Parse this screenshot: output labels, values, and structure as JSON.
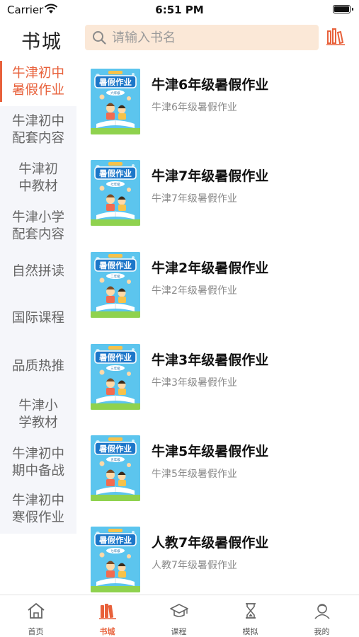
{
  "status_bar": {
    "carrier": "Carrier",
    "time": "6:51 PM"
  },
  "header": {
    "title": "书城"
  },
  "search": {
    "placeholder": "请输入书名"
  },
  "sidebar": {
    "items": [
      {
        "label_line1": "牛津初中",
        "label_line2": "暑假作业",
        "active": true
      },
      {
        "label_line1": "牛津初中",
        "label_line2": "配套内容",
        "active": false
      },
      {
        "label_line1": "牛津初",
        "label_line2": "中教材",
        "active": false
      },
      {
        "label_line1": "牛津小学",
        "label_line2": "配套内容",
        "active": false
      },
      {
        "label_line1": "自然拼读",
        "label_line2": "",
        "active": false
      },
      {
        "label_line1": "国际课程",
        "label_line2": "",
        "active": false
      },
      {
        "label_line1": "品质热推",
        "label_line2": "",
        "active": false
      },
      {
        "label_line1": "牛津小",
        "label_line2": "学教材",
        "active": false
      },
      {
        "label_line1": "牛津初中",
        "label_line2": "期中备战",
        "active": false
      },
      {
        "label_line1": "牛津初中",
        "label_line2": "寒假作业",
        "active": false
      }
    ]
  },
  "books": [
    {
      "title": "牛津6年级暑假作业",
      "subtitle": "牛津6年级暑假作业",
      "cover_text": "暑假作业",
      "cover_grade": "六年级"
    },
    {
      "title": "牛津7年级暑假作业",
      "subtitle": "牛津7年级暑假作业",
      "cover_text": "暑假作业",
      "cover_grade": "七年级"
    },
    {
      "title": "牛津2年级暑假作业",
      "subtitle": "牛津2年级暑假作业",
      "cover_text": "暑假作业",
      "cover_grade": "二年级"
    },
    {
      "title": "牛津3年级暑假作业",
      "subtitle": "牛津3年级暑假作业",
      "cover_text": "暑假作业",
      "cover_grade": "三年级"
    },
    {
      "title": "牛津5年级暑假作业",
      "subtitle": "牛津5年级暑假作业",
      "cover_text": "暑假作业",
      "cover_grade": "五年级"
    },
    {
      "title": "人教7年级暑假作业",
      "subtitle": "人教7年级暑假作业",
      "cover_text": "暑假作业",
      "cover_grade": "七年级"
    }
  ],
  "tabbar": {
    "tabs": [
      {
        "label": "首页",
        "icon": "home-icon",
        "active": false
      },
      {
        "label": "书城",
        "icon": "books-icon",
        "active": true
      },
      {
        "label": "课程",
        "icon": "graduation-cap-icon",
        "active": false
      },
      {
        "label": "模拟",
        "icon": "hourglass-icon",
        "active": false
      },
      {
        "label": "我的",
        "icon": "profile-icon",
        "active": false
      }
    ]
  },
  "colors": {
    "accent": "#e8613b",
    "search_bg": "#fbe8d7",
    "sidebar_bg": "#f5f6fa",
    "cover_bg": "#5cc5ee"
  }
}
